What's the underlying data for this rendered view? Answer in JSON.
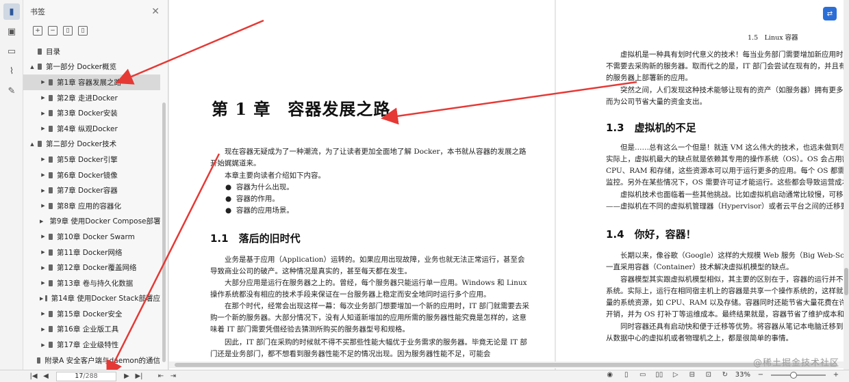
{
  "panel": {
    "title": "书签",
    "bookmarks": [
      {
        "label": "目录",
        "level": 0,
        "expand": ""
      },
      {
        "label": "第一部分 Docker概览",
        "level": 0,
        "expand": "▲"
      },
      {
        "label": "第1章 容器发展之路",
        "level": 1,
        "expand": "▶",
        "selected": true
      },
      {
        "label": "第2章 走进Docker",
        "level": 1,
        "expand": "▶"
      },
      {
        "label": "第3章 Docker安装",
        "level": 1,
        "expand": "▶"
      },
      {
        "label": "第4章 纵观Docker",
        "level": 1,
        "expand": "▶"
      },
      {
        "label": "第二部分 Docker技术",
        "level": 0,
        "expand": "▲"
      },
      {
        "label": "第5章 Docker引擎",
        "level": 1,
        "expand": "▶"
      },
      {
        "label": "第6章 Docker镜像",
        "level": 1,
        "expand": "▶"
      },
      {
        "label": "第7章 Docker容器",
        "level": 1,
        "expand": "▶"
      },
      {
        "label": "第8章 应用的容器化",
        "level": 1,
        "expand": "▶"
      },
      {
        "label": "第9章 使用Docker Compose部署",
        "level": 1,
        "expand": "▶"
      },
      {
        "label": "第10章 Docker Swarm",
        "level": 1,
        "expand": "▶"
      },
      {
        "label": "第11章 Docker网络",
        "level": 1,
        "expand": "▶"
      },
      {
        "label": "第12章 Docker覆盖网络",
        "level": 1,
        "expand": "▶"
      },
      {
        "label": "第13章 卷与持久化数据",
        "level": 1,
        "expand": "▶"
      },
      {
        "label": "第14章 使用Docker Stack部署应",
        "level": 1,
        "expand": "▶"
      },
      {
        "label": "第15章 Docker安全",
        "level": 1,
        "expand": "▶"
      },
      {
        "label": "第16章 企业版工具",
        "level": 1,
        "expand": "▶"
      },
      {
        "label": "第17章 企业级特性",
        "level": 1,
        "expand": "▶"
      },
      {
        "label": "附录A 安全客户端与daemon的通信",
        "level": 0,
        "expand": ""
      }
    ]
  },
  "left_page": {
    "chapter_title": "第 1 章　容器发展之路",
    "intro": "现在容器无疑成为了一种潮流，为了让读者更加全面地了解 Docker，本书就从容器的发展之路开始娓娓道来。",
    "intro2": "本章主要向读者介绍如下内容。",
    "bullets": [
      "容器为什么出现。",
      "容器的作用。",
      "容器的应用场景。"
    ],
    "section_title": "1.1　落后的旧时代",
    "p1": "业务是基于应用（Application）运转的。如果应用出现故障，业务也就无法正常运行，甚至会导致商业公司的破产。这种情况是真实的，甚至每天都在发生。",
    "p2": "大部分应用是运行在服务器之上的。曾经，每个服务器只能运行单一应用。Windows 和 Linux 操作系统都没有相应的技术手段来保证在一台服务器上稳定而安全地同时运行多个应用。",
    "p3": "在那个时代，经常会出现这样一幕：每次业务部门想要增加一个新的应用时，IT 部门就需要去采购一个新的服务器。大部分情况下，没有人知道新增加的应用所需的服务器性能究竟是怎样的，这意味着 IT 部门需要凭借经验去猜测所购买的服务器型号和规格。",
    "p4": "因此，IT 部门在采购的时候就不得不买那些性能大幅优于业务需求的服务器。毕竟无论是 IT 部门还是业务部门，都不想看到服务器性能不足的情况出现。因为服务器性能不足，可能会"
  },
  "right_page": {
    "running_header": "1.5　Linux 容器",
    "p1": "虚拟机是一种具有划时代意义的技术！每当业务部门需要增加新应用时，IT 部门不需要去采购新的服务器。取而代之的是，IT 部门会尝试在现有的，并且有空闲性能的服务器上部署新的应用。",
    "p2": "突然之间，人们发现这种技术能够让现有的资产（如服务器）拥有更多的价值，从而为公司节省大量的资金支出。",
    "section_13": "1.3　虚拟机的不足",
    "p3": "但是……总有这么一个但是！就连 VM 这么伟大的技术，也远未做到尽善尽美。实际上，虚拟机最大的缺点就是依赖其专用的操作系统（OS）。OS 会占用额外的 CPU、RAM 和存储，这些资源本可以用于运行更多的应用。每个 OS 都需要补丁和监控。另外在某些情况下，OS 需要许可证才能运行。这些都会导致运营成本（OPEX）和资金性支出（CAPEX）的浪费。",
    "p4": "虚拟机技术也面临着一些其他挑战。比如虚拟机启动通常比较慢，可移植性比较差——虚拟机在不同的虚拟机管理器（Hypervisor）或者云平台之间的迁移要远比想象中困难。",
    "section_14": "1.4　你好，容器！",
    "p5": "长期以来，像谷歌（Google）这样的大规模 Web 服务（Big Web-Scale）玩家一直采用容器（Container）技术解决虚拟机模型的缺点。",
    "p6": "容器模型其实跟虚拟机模型相似，其主要的区别在于，容器的运行并不会独占操作系统。实际上，运行在相同宿主机上的容器是共享一个操作系统的，这样就能够节省大量的系统资源，如 CPU、RAM 以及存储。容器同时还能节省大量花费在许可证上的开销，并为 OS 打补丁等运维成本。最终结果就是，容器节省了维护成本和资金成本。",
    "p7": "同时容器还具有启动快和便于迁移等优势。将容器从笔记本电脑迁移到云上，或者从数据中心的虚拟机或者物理机之上，都是很简单的事情。"
  },
  "status": {
    "page_current": "17",
    "page_total": "/288",
    "zoom": "33%"
  },
  "watermark": "@稀土掘金技术社区",
  "colors": {
    "accent": "#2b6fd6",
    "annotation_arrow": "#e53935"
  }
}
